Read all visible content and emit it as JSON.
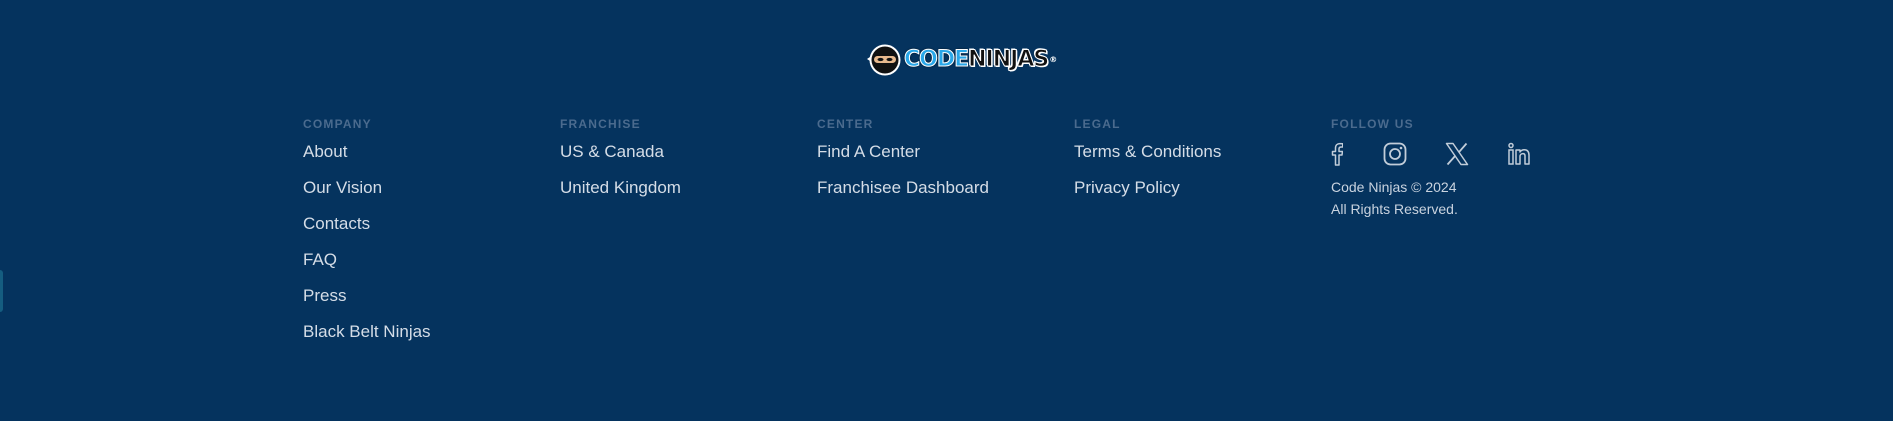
{
  "logo": {
    "code_text": "CODE",
    "ninjas_text": "NINJAS",
    "reg_mark": "®"
  },
  "columns": {
    "company": {
      "heading": "COMPANY",
      "links": [
        "About",
        "Our Vision",
        "Contacts",
        "FAQ",
        "Press",
        "Black Belt Ninjas"
      ]
    },
    "franchise": {
      "heading": "FRANCHISE",
      "links": [
        "US & Canada",
        "United Kingdom"
      ]
    },
    "center": {
      "heading": "CENTER",
      "links": [
        "Find A Center",
        "Franchisee Dashboard"
      ]
    },
    "legal": {
      "heading": "LEGAL",
      "links": [
        "Terms & Conditions",
        "Privacy Policy"
      ]
    },
    "follow": {
      "heading": "FOLLOW US",
      "social_icons": [
        "facebook-icon",
        "instagram-icon",
        "x-twitter-icon",
        "linkedin-icon"
      ],
      "copyright_line1": "Code Ninjas © 2024",
      "copyright_line2": "All Rights Reserved."
    }
  },
  "colors": {
    "background": "#05335e",
    "heading": "#4b6b8e",
    "link": "#d5dde7",
    "logo_blue": "#29a7e8"
  }
}
